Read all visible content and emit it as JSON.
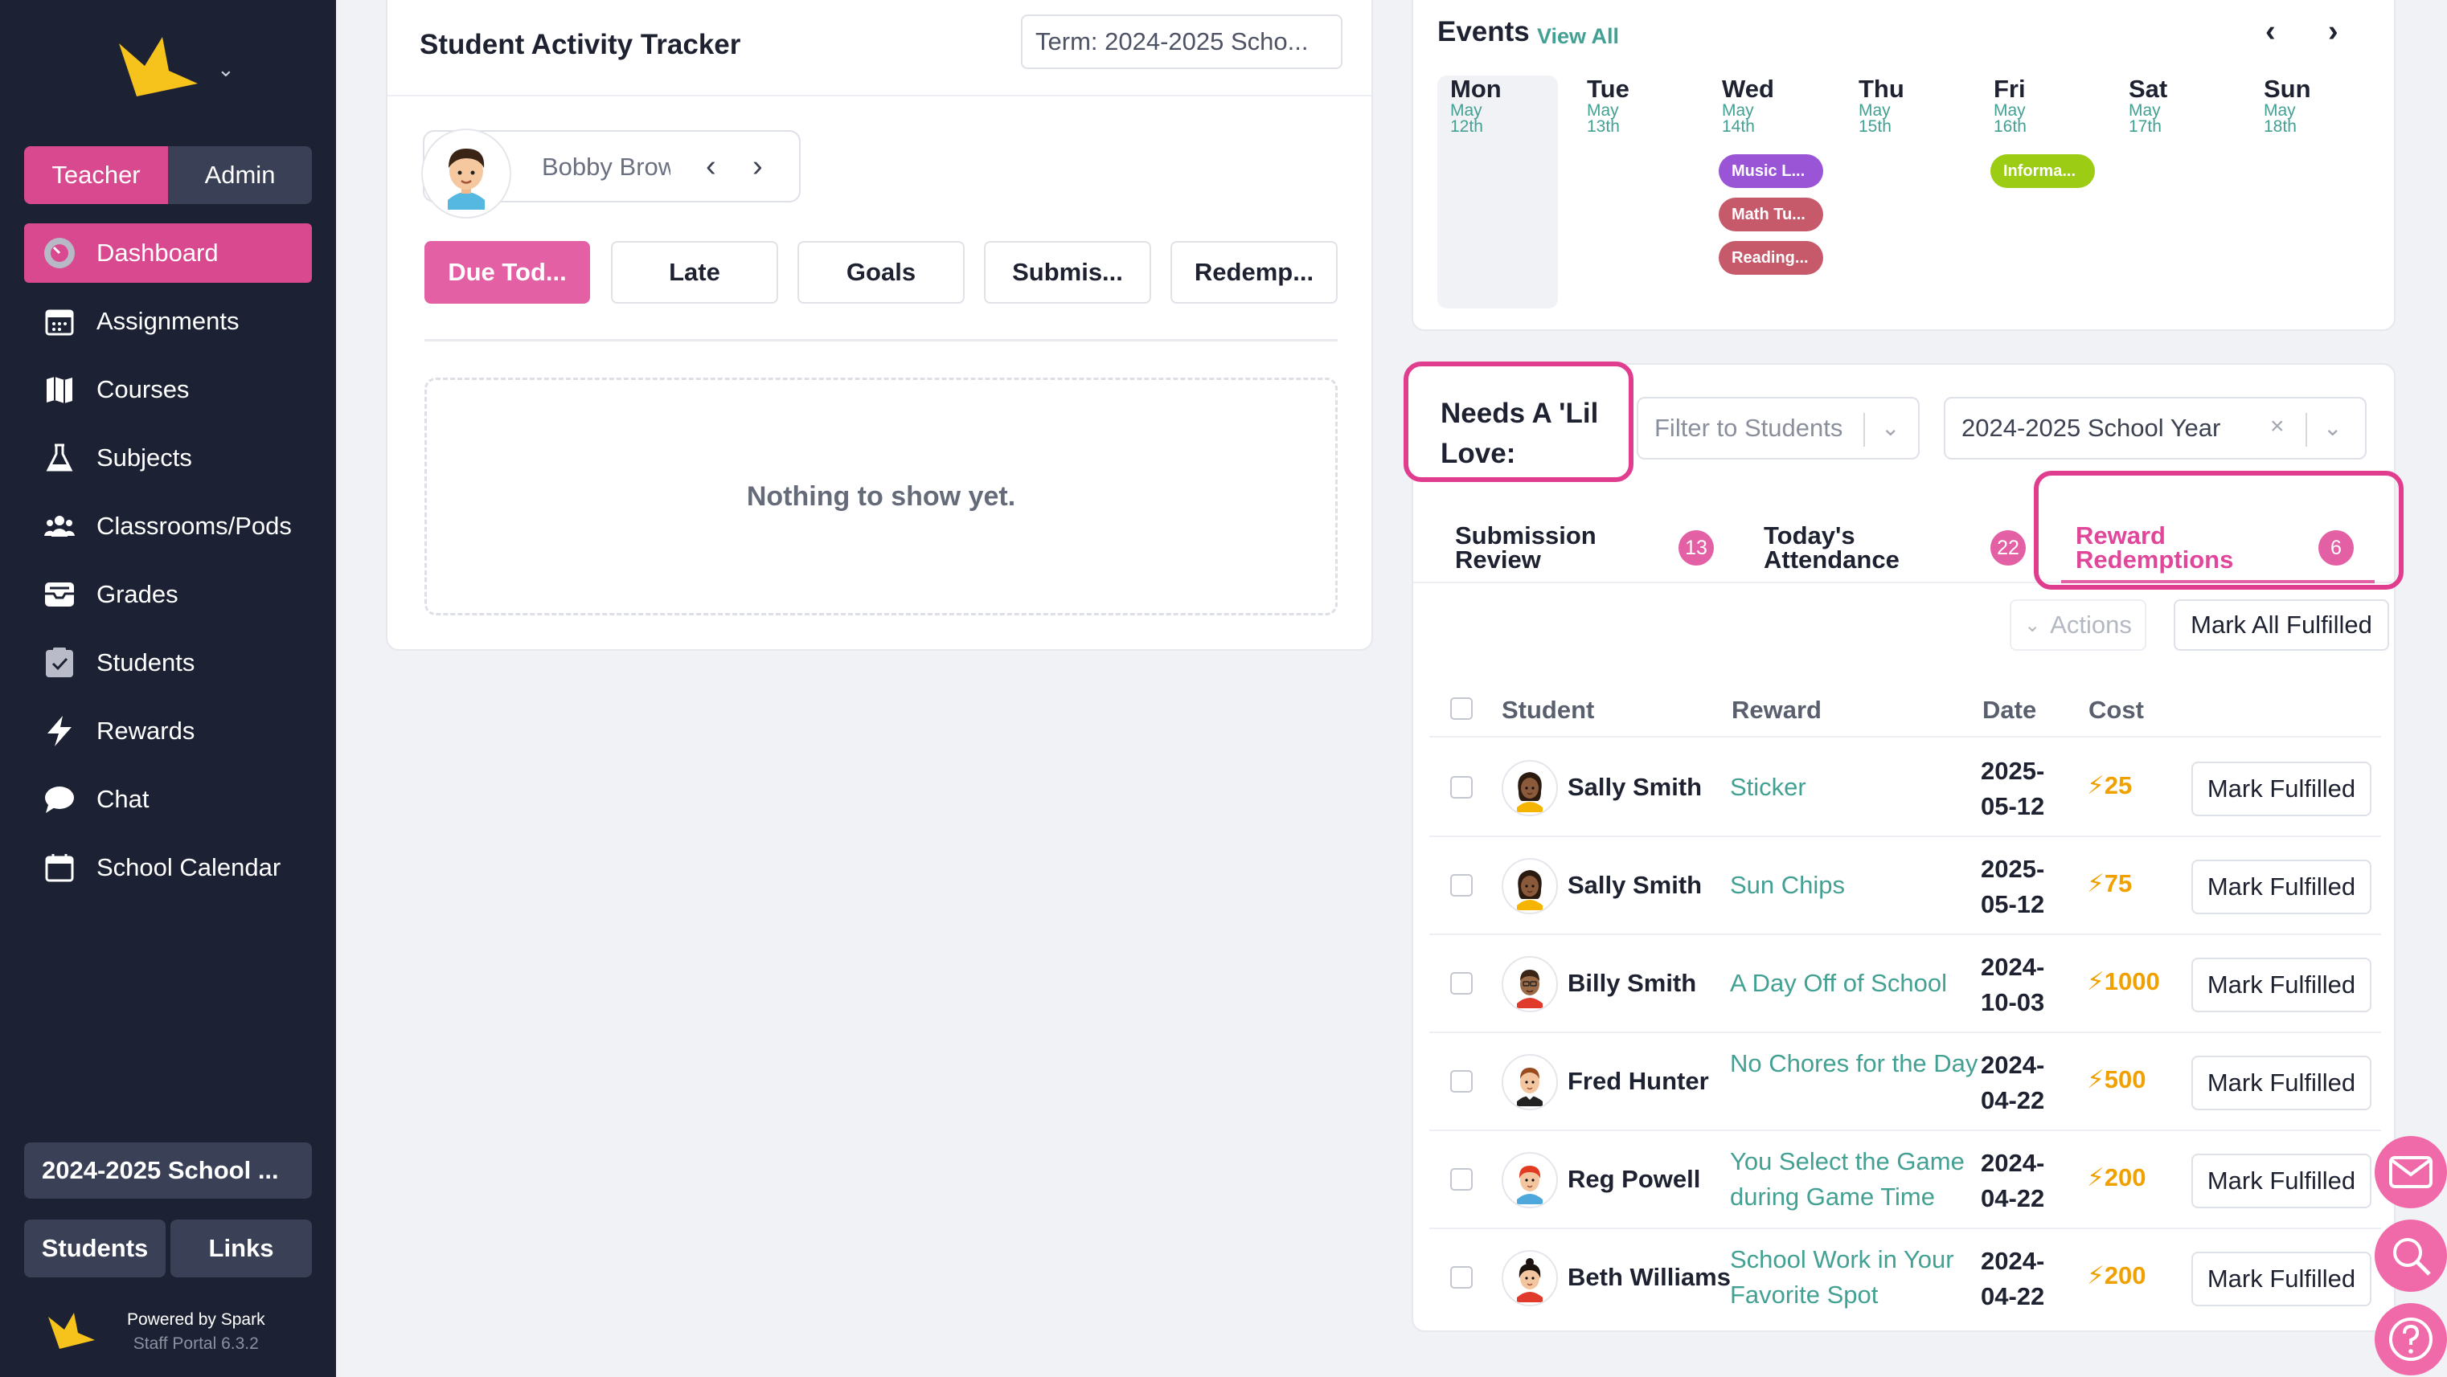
{
  "sidebar": {
    "roles": [
      "Teacher",
      "Admin"
    ],
    "active_role": "Teacher",
    "nav": [
      {
        "label": "Dashboard",
        "icon": "dashboard-icon",
        "active": true
      },
      {
        "label": "Assignments",
        "icon": "calendar-icon",
        "active": false
      },
      {
        "label": "Courses",
        "icon": "map-icon",
        "active": false
      },
      {
        "label": "Subjects",
        "icon": "flask-icon",
        "active": false
      },
      {
        "label": "Classrooms/Pods",
        "icon": "people-icon",
        "active": false
      },
      {
        "label": "Grades",
        "icon": "inbox-icon",
        "active": false
      },
      {
        "label": "Students",
        "icon": "checkbox-icon",
        "active": false
      },
      {
        "label": "Rewards",
        "icon": "bolt-icon",
        "active": false
      },
      {
        "label": "Chat",
        "icon": "chat-icon",
        "active": false
      },
      {
        "label": "School Calendar",
        "icon": "calendar-blank-icon",
        "active": false
      }
    ],
    "year_button": "2024-2025 School ...",
    "bottom_buttons": [
      "Students",
      "Links"
    ],
    "powered_by": "Powered by Spark",
    "version": "Staff Portal 6.3.2"
  },
  "tracker": {
    "title": "Student Activity Tracker",
    "term": "Term: 2024-2025 Scho...",
    "student_name": "Bobby Brown",
    "tabs": [
      "Due Tod...",
      "Late",
      "Goals",
      "Submis...",
      "Redemp..."
    ],
    "active_tab": "Due Tod...",
    "empty_text": "Nothing to show yet."
  },
  "events": {
    "title": "Events",
    "view_all": "View All",
    "days": [
      {
        "name": "Mon",
        "month": "May",
        "date": "12th",
        "today": true,
        "events": []
      },
      {
        "name": "Tue",
        "month": "May",
        "date": "13th",
        "events": []
      },
      {
        "name": "Wed",
        "month": "May",
        "date": "14th",
        "events": [
          {
            "label": "Music L...",
            "color": "#9a55d6"
          },
          {
            "label": "Math Tu...",
            "color": "#c65a6a"
          },
          {
            "label": "Reading...",
            "color": "#c65a6a"
          }
        ]
      },
      {
        "name": "Thu",
        "month": "May",
        "date": "15th",
        "events": []
      },
      {
        "name": "Fri",
        "month": "May",
        "date": "16th",
        "events": [
          {
            "label": "Informa...",
            "color": "#9ccc13"
          }
        ]
      },
      {
        "name": "Sat",
        "month": "May",
        "date": "17th",
        "events": []
      },
      {
        "name": "Sun",
        "month": "May",
        "date": "18th",
        "events": []
      }
    ]
  },
  "love": {
    "title": "Needs A 'Lil Love:",
    "filter_placeholder": "Filter to Students",
    "year": "2024-2025 School Year",
    "tabs": [
      {
        "label_1": "Submission",
        "label_2": "Review",
        "count": "13"
      },
      {
        "label_1": "Today's",
        "label_2": "Attendance",
        "count": "22"
      },
      {
        "label_1": "Reward",
        "label_2": "Redemptions",
        "count": "6",
        "active": true
      }
    ],
    "actions_label": "Actions",
    "mark_all_label": "Mark All Fulfilled",
    "columns": {
      "student": "Student",
      "reward": "Reward",
      "date": "Date",
      "cost": "Cost"
    },
    "rows": [
      {
        "student": "Sally Smith",
        "reward": "Sticker",
        "date_1": "2025-",
        "date_2": "05-12",
        "cost": "25",
        "avatar": "girl-avatar",
        "action": "Mark Fulfilled"
      },
      {
        "student": "Sally Smith",
        "reward": "Sun Chips",
        "date_1": "2025-",
        "date_2": "05-12",
        "cost": "75",
        "avatar": "girl-avatar",
        "action": "Mark Fulfilled"
      },
      {
        "student": "Billy Smith",
        "reward": "A Day Off of School",
        "date_1": "2024-",
        "date_2": "10-03",
        "cost": "1000",
        "avatar": "boy-avatar",
        "action": "Mark Fulfilled"
      },
      {
        "student": "Fred Hunter",
        "reward": "No Chores for the Day",
        "date_1": "2024-",
        "date_2": "04-22",
        "cost": "500",
        "avatar": "boy-avatar",
        "action": "Mark Fulfilled"
      },
      {
        "student": "Reg Powell",
        "reward": "You Select the Game during Game Time",
        "date_1": "2024-",
        "date_2": "04-22",
        "cost": "200",
        "avatar": "boy-red-hair-avatar",
        "action": "Mark Fulfilled"
      },
      {
        "student": "Beth Williams",
        "reward": "School Work in Your Favorite Spot",
        "date_1": "2024-",
        "date_2": "04-22",
        "cost": "200",
        "avatar": "girl-avatar",
        "action": "Mark Fulfilled"
      }
    ]
  },
  "colors": {
    "accent": "#d8498f",
    "teal": "#43a193",
    "gold": "#f0a100",
    "sidebar": "#1c2233"
  },
  "fabs": [
    "mail-icon",
    "search-icon",
    "help-icon"
  ]
}
